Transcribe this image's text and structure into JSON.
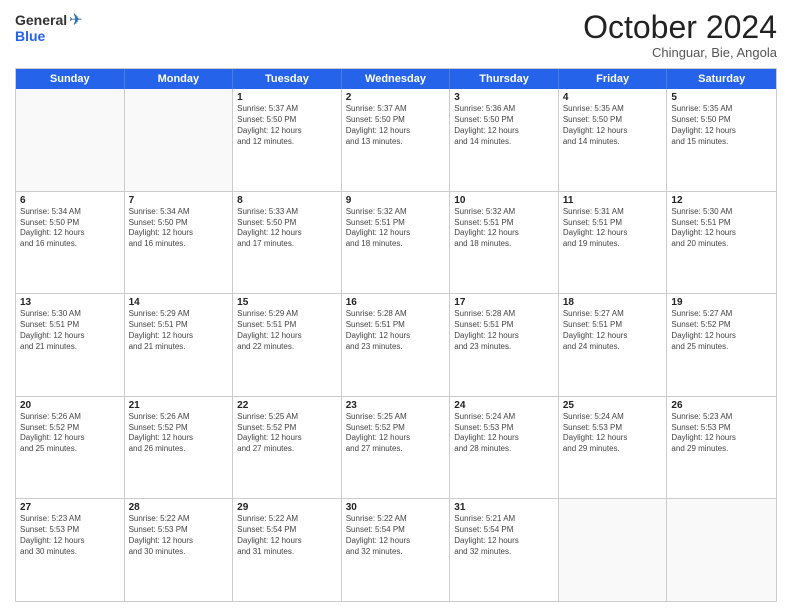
{
  "logo": {
    "general": "General",
    "blue": "Blue"
  },
  "header": {
    "month": "October 2024",
    "location": "Chinguar, Bie, Angola"
  },
  "days": [
    "Sunday",
    "Monday",
    "Tuesday",
    "Wednesday",
    "Thursday",
    "Friday",
    "Saturday"
  ],
  "weeks": [
    [
      {
        "day": "",
        "empty": true
      },
      {
        "day": "",
        "empty": true
      },
      {
        "day": "1",
        "lines": [
          "Sunrise: 5:37 AM",
          "Sunset: 5:50 PM",
          "Daylight: 12 hours",
          "and 12 minutes."
        ]
      },
      {
        "day": "2",
        "lines": [
          "Sunrise: 5:37 AM",
          "Sunset: 5:50 PM",
          "Daylight: 12 hours",
          "and 13 minutes."
        ]
      },
      {
        "day": "3",
        "lines": [
          "Sunrise: 5:36 AM",
          "Sunset: 5:50 PM",
          "Daylight: 12 hours",
          "and 14 minutes."
        ]
      },
      {
        "day": "4",
        "lines": [
          "Sunrise: 5:35 AM",
          "Sunset: 5:50 PM",
          "Daylight: 12 hours",
          "and 14 minutes."
        ]
      },
      {
        "day": "5",
        "lines": [
          "Sunrise: 5:35 AM",
          "Sunset: 5:50 PM",
          "Daylight: 12 hours",
          "and 15 minutes."
        ]
      }
    ],
    [
      {
        "day": "6",
        "lines": [
          "Sunrise: 5:34 AM",
          "Sunset: 5:50 PM",
          "Daylight: 12 hours",
          "and 16 minutes."
        ]
      },
      {
        "day": "7",
        "lines": [
          "Sunrise: 5:34 AM",
          "Sunset: 5:50 PM",
          "Daylight: 12 hours",
          "and 16 minutes."
        ]
      },
      {
        "day": "8",
        "lines": [
          "Sunrise: 5:33 AM",
          "Sunset: 5:50 PM",
          "Daylight: 12 hours",
          "and 17 minutes."
        ]
      },
      {
        "day": "9",
        "lines": [
          "Sunrise: 5:32 AM",
          "Sunset: 5:51 PM",
          "Daylight: 12 hours",
          "and 18 minutes."
        ]
      },
      {
        "day": "10",
        "lines": [
          "Sunrise: 5:32 AM",
          "Sunset: 5:51 PM",
          "Daylight: 12 hours",
          "and 18 minutes."
        ]
      },
      {
        "day": "11",
        "lines": [
          "Sunrise: 5:31 AM",
          "Sunset: 5:51 PM",
          "Daylight: 12 hours",
          "and 19 minutes."
        ]
      },
      {
        "day": "12",
        "lines": [
          "Sunrise: 5:30 AM",
          "Sunset: 5:51 PM",
          "Daylight: 12 hours",
          "and 20 minutes."
        ]
      }
    ],
    [
      {
        "day": "13",
        "lines": [
          "Sunrise: 5:30 AM",
          "Sunset: 5:51 PM",
          "Daylight: 12 hours",
          "and 21 minutes."
        ]
      },
      {
        "day": "14",
        "lines": [
          "Sunrise: 5:29 AM",
          "Sunset: 5:51 PM",
          "Daylight: 12 hours",
          "and 21 minutes."
        ]
      },
      {
        "day": "15",
        "lines": [
          "Sunrise: 5:29 AM",
          "Sunset: 5:51 PM",
          "Daylight: 12 hours",
          "and 22 minutes."
        ]
      },
      {
        "day": "16",
        "lines": [
          "Sunrise: 5:28 AM",
          "Sunset: 5:51 PM",
          "Daylight: 12 hours",
          "and 23 minutes."
        ]
      },
      {
        "day": "17",
        "lines": [
          "Sunrise: 5:28 AM",
          "Sunset: 5:51 PM",
          "Daylight: 12 hours",
          "and 23 minutes."
        ]
      },
      {
        "day": "18",
        "lines": [
          "Sunrise: 5:27 AM",
          "Sunset: 5:51 PM",
          "Daylight: 12 hours",
          "and 24 minutes."
        ]
      },
      {
        "day": "19",
        "lines": [
          "Sunrise: 5:27 AM",
          "Sunset: 5:52 PM",
          "Daylight: 12 hours",
          "and 25 minutes."
        ]
      }
    ],
    [
      {
        "day": "20",
        "lines": [
          "Sunrise: 5:26 AM",
          "Sunset: 5:52 PM",
          "Daylight: 12 hours",
          "and 25 minutes."
        ]
      },
      {
        "day": "21",
        "lines": [
          "Sunrise: 5:26 AM",
          "Sunset: 5:52 PM",
          "Daylight: 12 hours",
          "and 26 minutes."
        ]
      },
      {
        "day": "22",
        "lines": [
          "Sunrise: 5:25 AM",
          "Sunset: 5:52 PM",
          "Daylight: 12 hours",
          "and 27 minutes."
        ]
      },
      {
        "day": "23",
        "lines": [
          "Sunrise: 5:25 AM",
          "Sunset: 5:52 PM",
          "Daylight: 12 hours",
          "and 27 minutes."
        ]
      },
      {
        "day": "24",
        "lines": [
          "Sunrise: 5:24 AM",
          "Sunset: 5:53 PM",
          "Daylight: 12 hours",
          "and 28 minutes."
        ]
      },
      {
        "day": "25",
        "lines": [
          "Sunrise: 5:24 AM",
          "Sunset: 5:53 PM",
          "Daylight: 12 hours",
          "and 29 minutes."
        ]
      },
      {
        "day": "26",
        "lines": [
          "Sunrise: 5:23 AM",
          "Sunset: 5:53 PM",
          "Daylight: 12 hours",
          "and 29 minutes."
        ]
      }
    ],
    [
      {
        "day": "27",
        "lines": [
          "Sunrise: 5:23 AM",
          "Sunset: 5:53 PM",
          "Daylight: 12 hours",
          "and 30 minutes."
        ]
      },
      {
        "day": "28",
        "lines": [
          "Sunrise: 5:22 AM",
          "Sunset: 5:53 PM",
          "Daylight: 12 hours",
          "and 30 minutes."
        ]
      },
      {
        "day": "29",
        "lines": [
          "Sunrise: 5:22 AM",
          "Sunset: 5:54 PM",
          "Daylight: 12 hours",
          "and 31 minutes."
        ]
      },
      {
        "day": "30",
        "lines": [
          "Sunrise: 5:22 AM",
          "Sunset: 5:54 PM",
          "Daylight: 12 hours",
          "and 32 minutes."
        ]
      },
      {
        "day": "31",
        "lines": [
          "Sunrise: 5:21 AM",
          "Sunset: 5:54 PM",
          "Daylight: 12 hours",
          "and 32 minutes."
        ]
      },
      {
        "day": "",
        "empty": true
      },
      {
        "day": "",
        "empty": true
      }
    ]
  ]
}
